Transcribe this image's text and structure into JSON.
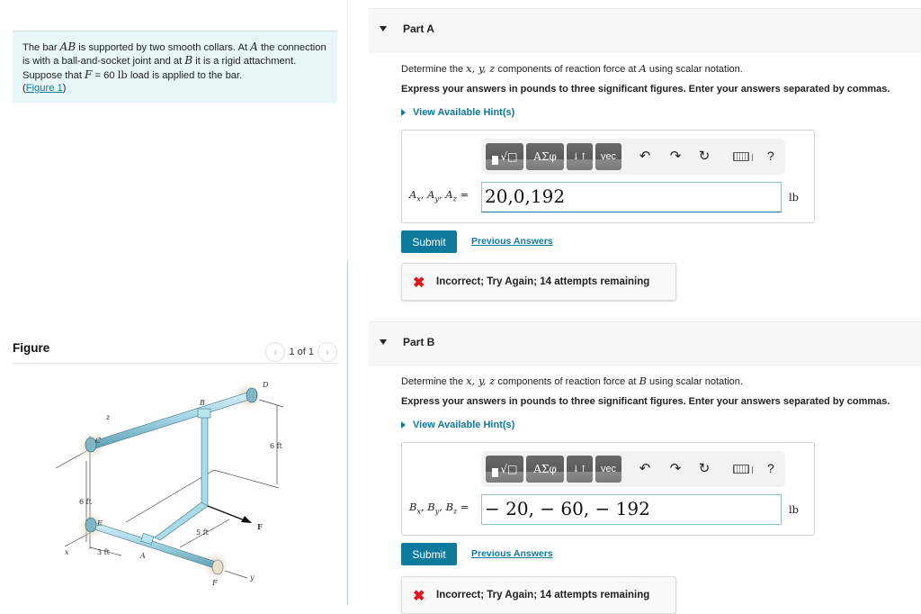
{
  "problem": {
    "text_parts": [
      "The bar ",
      "AB",
      " is supported by two smooth collars. At ",
      "A",
      " the connection is with a ball-and-socket joint and at ",
      "B",
      " it is a rigid attachment. Suppose that ",
      "F",
      " = 60 ",
      "lb",
      " load is applied to the bar."
    ],
    "figure_link_prefix": "(",
    "figure_link": "Figure 1",
    "figure_link_suffix": ")"
  },
  "figure_panel": {
    "title": "Figure",
    "pager_text": "1 of 1",
    "prev_icon": "chevron-left-icon",
    "next_icon": "chevron-right-icon",
    "labels": {
      "B": "B",
      "D": "D",
      "z": "z",
      "C": "C",
      "six_ft_right": "6 ft",
      "six_ft_left": "6 ft",
      "E": "E",
      "five_ft": "5 ft",
      "F_force": "F",
      "x": "x",
      "three_ft": "3 ft",
      "A": "A",
      "F_collar": "F",
      "y": "y"
    }
  },
  "colors": {
    "accent": "#0e7a9b",
    "problem_bg": "#e8f6f7",
    "error": "#e0141e",
    "pipe": "#9fd3e3"
  },
  "parts": [
    {
      "title": "Part A",
      "question_prefix": "Determine the ",
      "question_vars": "x, y, z",
      "question_mid": " components of reaction force at ",
      "question_point": "A",
      "question_suffix": " using scalar notation.",
      "instructions": "Express your answers in pounds to three significant figures. Enter your answers separated by commas.",
      "hint_label": "View Available Hint(s)",
      "answer_label": "Ax, Ay, Az =",
      "answer_value": "20,0,192",
      "unit": "lb",
      "submit_label": "Submit",
      "previous_answers_label": "Previous Answers",
      "feedback": "Incorrect; Try Again; 14 attempts remaining"
    },
    {
      "title": "Part B",
      "question_prefix": "Determine the ",
      "question_vars": "x, y, z",
      "question_mid": " components of reaction force at ",
      "question_point": "B",
      "question_suffix": " using scalar notation.",
      "instructions": "Express your answers in pounds to three significant figures. Enter your answers separated by commas.",
      "hint_label": "View Available Hint(s)",
      "answer_label": "Bx, By, Bz =",
      "answer_value": "− 20, − 60, − 192",
      "unit": "lb",
      "submit_label": "Submit",
      "previous_answers_label": "Previous Answers",
      "feedback": "Incorrect; Try Again; 14 attempts remaining"
    }
  ],
  "toolbar": {
    "templates_btn": "√□",
    "greek_btn": "ΑΣφ",
    "arrows_btn": "↓↑",
    "vec_btn": "vec",
    "undo_icon": "undo-icon",
    "redo_icon": "redo-icon",
    "reset_icon": "reset-icon",
    "keyboard_icon": "keyboard-icon",
    "help": "?"
  }
}
